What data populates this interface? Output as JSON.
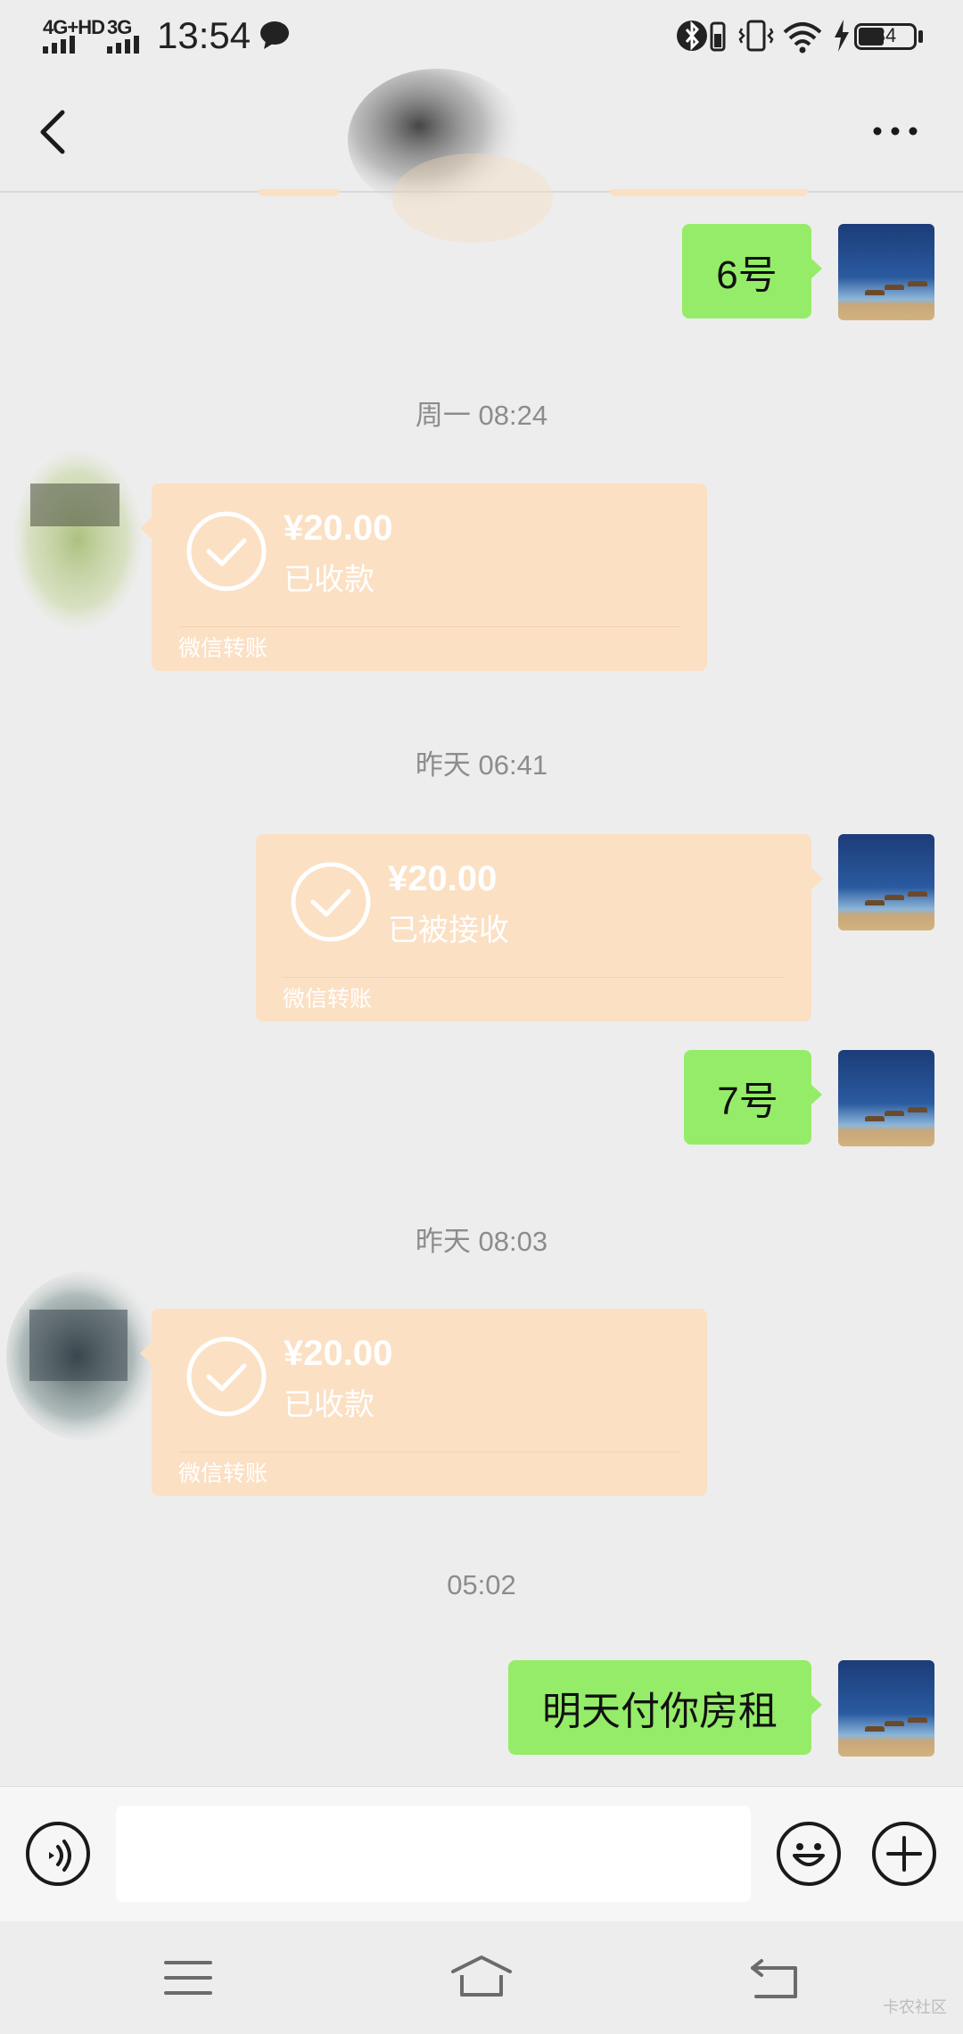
{
  "status_bar": {
    "network1": "4G+HD",
    "network2": "3G",
    "time": "13:54",
    "battery": "34"
  },
  "header": {
    "more_label": "···"
  },
  "messages": [
    {
      "type": "text",
      "side": "right",
      "text": "6号"
    },
    {
      "type": "time",
      "text": "周一 08:24"
    },
    {
      "type": "transfer",
      "side": "left",
      "amount": "¥20.00",
      "status": "已收款",
      "footer": "微信转账"
    },
    {
      "type": "time",
      "text": "昨天 06:41"
    },
    {
      "type": "transfer",
      "side": "right",
      "amount": "¥20.00",
      "status": "已被接收",
      "footer": "微信转账"
    },
    {
      "type": "text",
      "side": "right",
      "text": "7号"
    },
    {
      "type": "time",
      "text": "昨天 08:03"
    },
    {
      "type": "transfer",
      "side": "left",
      "amount": "¥20.00",
      "status": "已收款",
      "footer": "微信转账"
    },
    {
      "type": "time",
      "text": "05:02"
    },
    {
      "type": "text",
      "side": "right",
      "text": "明天付你房租"
    }
  ],
  "input": {
    "value": "",
    "placeholder": ""
  },
  "icons": {
    "back": "chevron-left-icon",
    "more": "more-dots-icon",
    "voice": "voice-icon",
    "emoji": "emoji-icon",
    "plus": "plus-icon",
    "menu": "menu-icon",
    "home": "home-icon",
    "return": "return-icon"
  },
  "colors": {
    "background": "#ededed",
    "sent_bubble": "#95ec69",
    "transfer_bubble": "#fbe0c4",
    "timestamp": "#8c8c8c"
  },
  "watermark": "卡农社区"
}
